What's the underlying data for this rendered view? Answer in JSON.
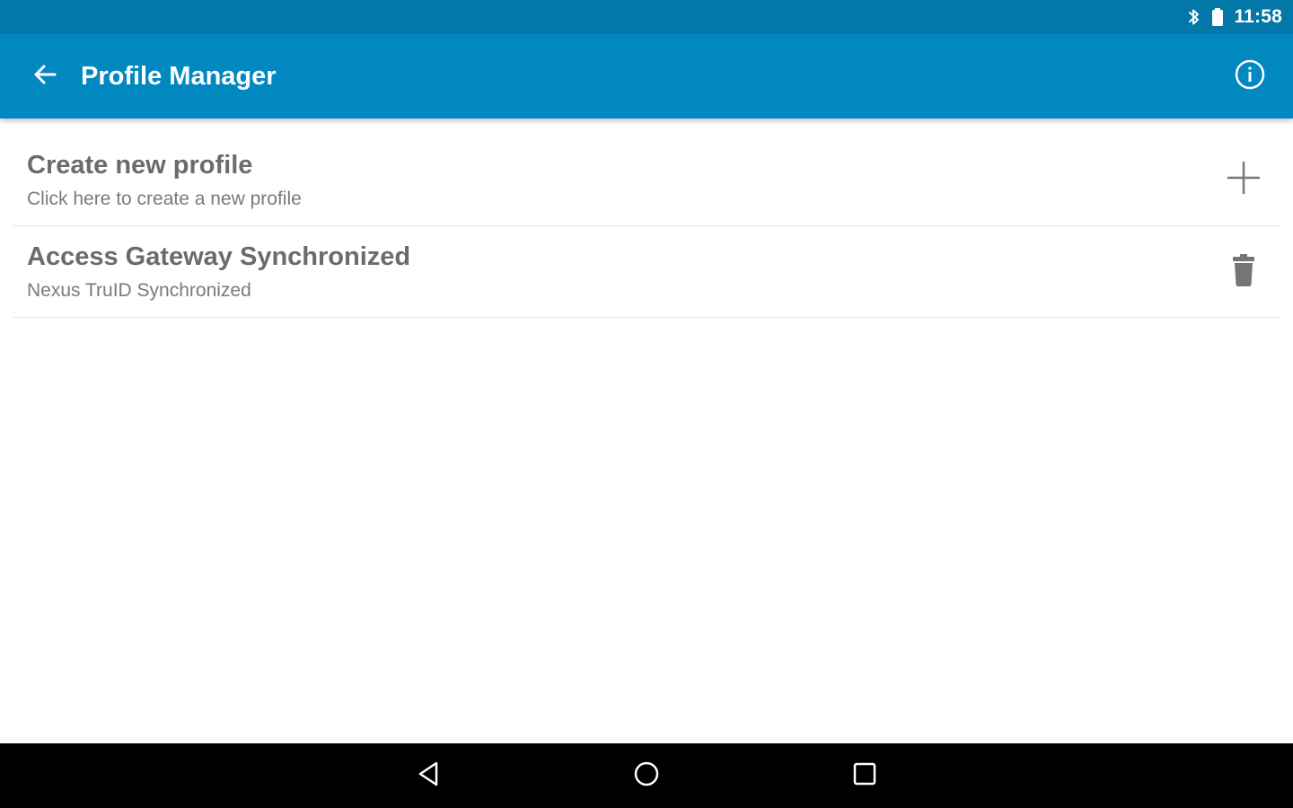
{
  "status_bar": {
    "time": "11:58",
    "icons": [
      "bluetooth-icon",
      "battery-icon"
    ],
    "color": "#0277a8"
  },
  "app_bar": {
    "title": "Profile Manager",
    "back_icon": "arrow-back-icon",
    "info_icon": "info-icon",
    "color": "#0288c0"
  },
  "profiles": {
    "items": [
      {
        "title": "Create new profile",
        "subtitle": "Click here to create a new profile",
        "action_icon": "plus-icon"
      },
      {
        "title": "Access Gateway Synchronized",
        "subtitle": "Nexus TruID Synchronized",
        "action_icon": "trash-icon"
      }
    ]
  },
  "nav_bar": {
    "buttons": [
      "nav-back-icon",
      "nav-home-icon",
      "nav-recents-icon"
    ]
  }
}
